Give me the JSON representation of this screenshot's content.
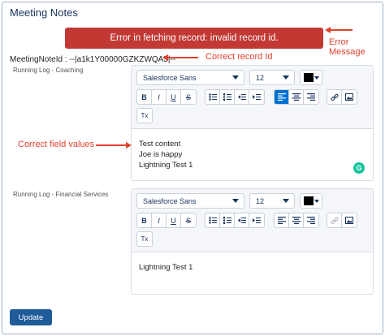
{
  "page": {
    "title": "Meeting Notes"
  },
  "error": {
    "message": "Error in fetching record: invalid record id."
  },
  "annotations": {
    "error_message": "Error Message",
    "error_word1": "Error",
    "error_word2": "Message",
    "record_id": "Correct record Id",
    "field_values": "Correct field values"
  },
  "record": {
    "label": "MeetingNoteId : --|a1k1Y00000GZKZWQA5|--"
  },
  "logs": [
    {
      "label": "Running Log - Coaching",
      "font": "Salesforce Sans",
      "size": "12",
      "color": "#000000",
      "content": [
        "Test content",
        "Joe is happy",
        "Lightning Test 1"
      ]
    },
    {
      "label": "Running Log - Financial Services",
      "font": "Salesforce Sans",
      "size": "12",
      "color": "#000000",
      "content": [
        "Lightning Test 1"
      ]
    }
  ],
  "toolbar": {
    "bold": "B",
    "italic": "I",
    "underline": "U",
    "strike": "S",
    "clear_format": "Tx"
  },
  "grammarly": {
    "badge": "G"
  },
  "actions": {
    "update_label": "Update"
  },
  "colors": {
    "error": "#c23934",
    "annotation": "#e0412d",
    "primary": "#1f5c99",
    "active": "#0070d2"
  }
}
